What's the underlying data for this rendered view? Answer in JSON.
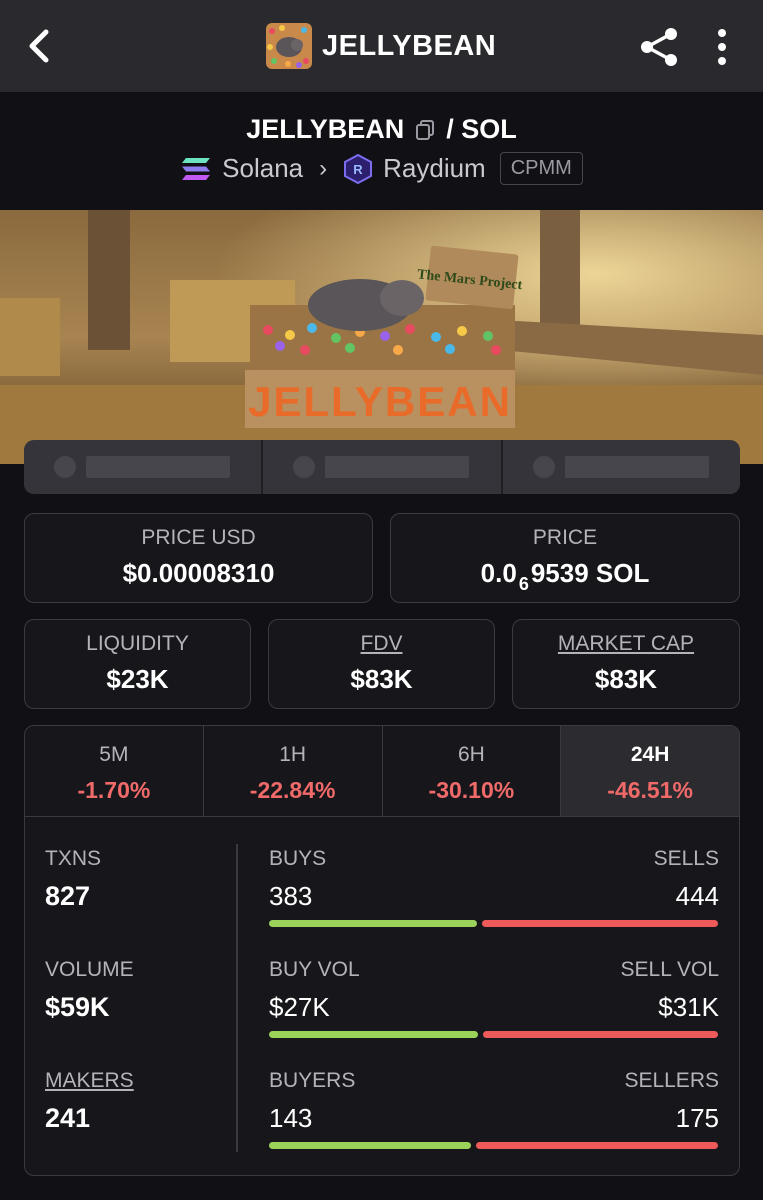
{
  "app": {
    "title": "JELLYBEAN"
  },
  "pair": {
    "base": "JELLYBEAN",
    "quote": "/ SOL",
    "chain": "Solana",
    "dex": "Raydium",
    "pool_type": "CPMM"
  },
  "banner": {
    "sign_text": "The Mars Project",
    "crate_text": "JELLYBEAN"
  },
  "stats": {
    "price_usd_label": "PRICE USD",
    "price_usd": "$0.00008310",
    "price_label": "PRICE",
    "price_prefix": "0.0",
    "price_zeros": "6",
    "price_suffix": "9539 SOL",
    "liquidity_label": "LIQUIDITY",
    "liquidity": "$23K",
    "fdv_label": "FDV",
    "fdv": "$83K",
    "mcap_label": "MARKET CAP",
    "mcap": "$83K"
  },
  "timeframes": [
    {
      "label": "5M",
      "change": "-1.70%"
    },
    {
      "label": "1H",
      "change": "-22.84%"
    },
    {
      "label": "6H",
      "change": "-30.10%"
    },
    {
      "label": "24H",
      "change": "-46.51%"
    }
  ],
  "selected_timeframe": "24H",
  "txns": {
    "txns_label": "TXNS",
    "txns": "827",
    "volume_label": "VOLUME",
    "volume": "$59K",
    "makers_label": "MAKERS",
    "makers": "241",
    "buys_label": "BUYS",
    "buys": "383",
    "sells_label": "SELLS",
    "sells": "444",
    "buy_vol_label": "BUY VOL",
    "buy_vol": "$27K",
    "sell_vol_label": "SELL VOL",
    "sell_vol": "$31K",
    "buyers_label": "BUYERS",
    "buyers": "143",
    "sellers_label": "SELLERS",
    "sellers": "175"
  },
  "ratios": {
    "buys_share": 0.463,
    "buy_vol_share": 0.465,
    "buyers_share": 0.45
  },
  "colors": {
    "positive": "#9ad25a",
    "negative": "#ee5a5a",
    "negative_text": "#f06a6a"
  },
  "icons": [
    "back-arrow-icon",
    "share-icon",
    "more-vertical-icon",
    "copy-icon",
    "solana-icon",
    "raydium-icon",
    "chevron-right-icon"
  ]
}
